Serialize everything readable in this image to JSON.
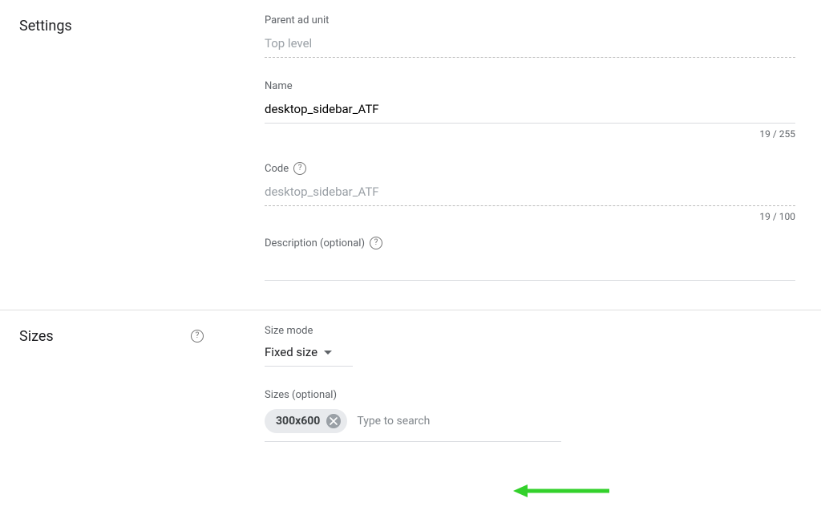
{
  "colors": {
    "annotation_arrow": "#33d12b"
  },
  "settings": {
    "heading": "Settings",
    "parent_ad_unit": {
      "label": "Parent ad unit",
      "value": "Top level"
    },
    "name": {
      "label": "Name",
      "value": "desktop_sidebar_ATF",
      "counter": "19 / 255"
    },
    "code": {
      "label": "Code",
      "value": "desktop_sidebar_ATF",
      "counter": "19 / 100"
    },
    "description": {
      "label": "Description (optional)",
      "value": ""
    }
  },
  "sizes": {
    "heading": "Sizes",
    "size_mode": {
      "label": "Size mode",
      "selected": "Fixed size"
    },
    "sizes_field": {
      "label": "Sizes (optional)",
      "chips": [
        {
          "label": "300x600"
        }
      ],
      "placeholder": "Type to search"
    }
  }
}
